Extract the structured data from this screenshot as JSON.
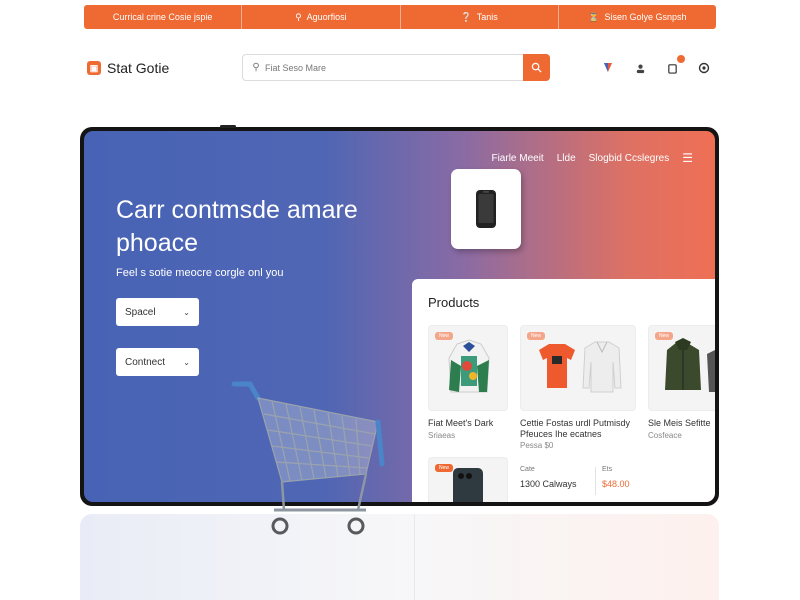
{
  "topbar": {
    "items": [
      {
        "label": "Currical crine Cosie jspie",
        "icon": ""
      },
      {
        "label": "Aguorfiosi",
        "icon": "search-icon"
      },
      {
        "label": "Tanis",
        "icon": "tag-icon"
      },
      {
        "label": "Sisen Golye Gsnpsh",
        "icon": "clock-icon"
      }
    ]
  },
  "header": {
    "logo_text": "Stat Gotie",
    "search_placeholder": "Fiat Seso Mare"
  },
  "hero": {
    "nav": [
      "Fiarle Meeit",
      "Llde",
      "Slogbid Ccslegres"
    ],
    "title": "Carr contmsde amare phoace",
    "subtitle": "Feel s sotie meocre corgle onl you",
    "buttons": [
      "Spacel",
      "Contnect"
    ]
  },
  "products": {
    "heading": "Products",
    "cards": [
      {
        "badge": "New",
        "name": "Fiat Meet's Dark",
        "sub": "Sriaeas"
      },
      {
        "badge": "New",
        "name": "Cettie Fostas urdl Putmisdy",
        "name2": "Pfeuces Ihe ecatnes",
        "sub": "Pessa $0"
      },
      {
        "badge": "New",
        "name": "Sle Meis Sefitte",
        "sub": "Cosfeace"
      }
    ],
    "bottom": {
      "label1": "Cate",
      "value1": "1300 Calways",
      "label2": "Ets",
      "value2": "$48.00"
    }
  },
  "colors": {
    "accent": "#ef6a33",
    "hero_left": "#4863b5",
    "hero_right": "#ef6f55"
  },
  "icons": [
    "search-icon",
    "location-icon",
    "user-icon",
    "cart-icon",
    "settings-icon",
    "menu-icon",
    "phone-icon"
  ]
}
